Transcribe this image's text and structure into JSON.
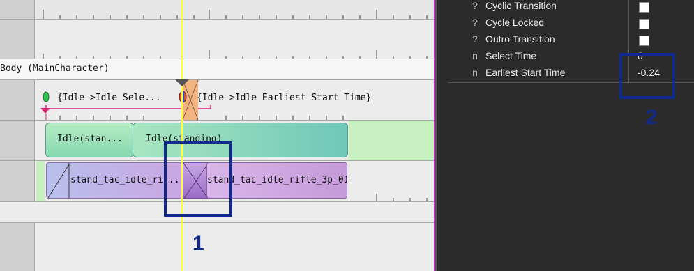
{
  "timeline": {
    "track_header": "Body (MainCharacter)",
    "events": {
      "idle_select": "{Idle->Idle Sele...",
      "idle_earliest": "{Idle->Idle Earliest Start Time}"
    },
    "states": {
      "idle_short": "Idle(stan...",
      "idle_long": "Idle(standing)"
    },
    "animations": {
      "anim_short": "stand_tac_idle_ri...",
      "anim_long": "stand_tac_idle_rifle_3p_01"
    }
  },
  "properties": {
    "rows": [
      {
        "type": "?",
        "name": "Cyclic Transition",
        "kind": "checkbox"
      },
      {
        "type": "?",
        "name": "Cycle Locked",
        "kind": "checkbox"
      },
      {
        "type": "?",
        "name": "Outro Transition",
        "kind": "checkbox"
      },
      {
        "type": "n",
        "name": "Select Time",
        "value": "0"
      },
      {
        "type": "n",
        "name": "Earliest Start Time",
        "value": "-0.24"
      }
    ]
  },
  "annotations": {
    "marker1": "1",
    "marker2": "2"
  },
  "colors": {
    "annotation": "#0f2a8c",
    "playhead": "#ffff33",
    "state_teal": "#7ed6c8",
    "state_green": "#c8f0c0",
    "anim_purple": "#c7a8e3",
    "event_pink": "#e0206f"
  }
}
